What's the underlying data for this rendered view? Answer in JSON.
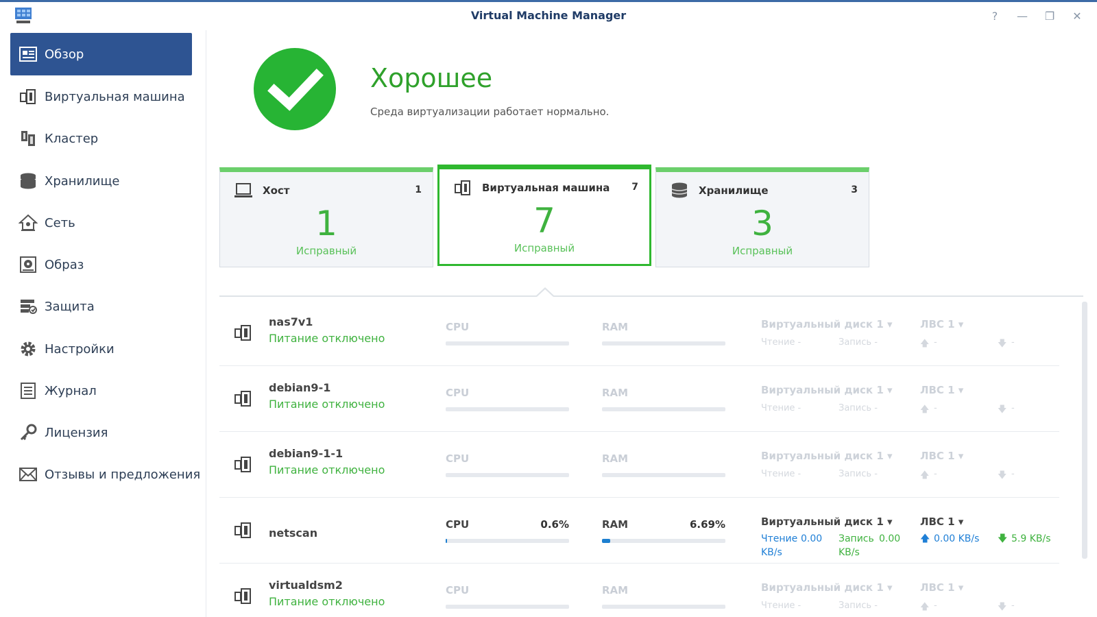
{
  "window": {
    "title": "Virtual Machine Manager"
  },
  "sidebar": {
    "items": [
      {
        "label": "Обзор",
        "icon": "overview-icon",
        "active": true
      },
      {
        "label": "Виртуальная машина",
        "icon": "vm-icon"
      },
      {
        "label": "Кластер",
        "icon": "cluster-icon"
      },
      {
        "label": "Хранилище",
        "icon": "storage-icon"
      },
      {
        "label": "Сеть",
        "icon": "network-icon"
      },
      {
        "label": "Образ",
        "icon": "image-icon"
      },
      {
        "label": "Защита",
        "icon": "protection-icon"
      },
      {
        "label": "Настройки",
        "icon": "gear-icon"
      },
      {
        "label": "Журнал",
        "icon": "log-icon"
      },
      {
        "label": "Лицензия",
        "icon": "key-icon"
      },
      {
        "label": "Отзывы и предложения",
        "icon": "mail-icon"
      }
    ]
  },
  "status": {
    "title": "Хорошее",
    "description": "Среда виртуализации работает нормально.",
    "color": "#27b434"
  },
  "cards": [
    {
      "title": "Хост",
      "count": "1",
      "big": "1",
      "sub": "Исправный"
    },
    {
      "title": "Виртуальная машина",
      "count": "7",
      "big": "7",
      "sub": "Исправный"
    },
    {
      "title": "Хранилище",
      "count": "3",
      "big": "3",
      "sub": "Исправный"
    }
  ],
  "vms": [
    {
      "name": "nas7v1",
      "status": "Питание отключено"
    },
    {
      "name": "debian9-1",
      "status": "Питание отключено"
    },
    {
      "name": "debian9-1-1",
      "status": "Питание отключено"
    },
    {
      "name": "netscan",
      "status": "",
      "cpu": "0.6%",
      "ram": "6.69%",
      "cpu_fraction": 0.006,
      "ram_fraction": 0.0669,
      "read_label": "Чтение",
      "read_value": "0.00",
      "read_unit": "KB/s",
      "write_label": "Запись",
      "write_value": "0.00",
      "write_unit": "KB/s",
      "upload": "0.00 KB/s",
      "download": "5.9 KB/s"
    },
    {
      "name": "virtualdsm2",
      "status": "Питание отключено"
    }
  ],
  "labels": {
    "cpu": "CPU",
    "ram": "RAM",
    "disk": "Виртуальный диск 1 ▾",
    "lan": "ЛВС 1 ▾",
    "read": "Чтение -",
    "write": "Запись -",
    "dash": "-"
  }
}
